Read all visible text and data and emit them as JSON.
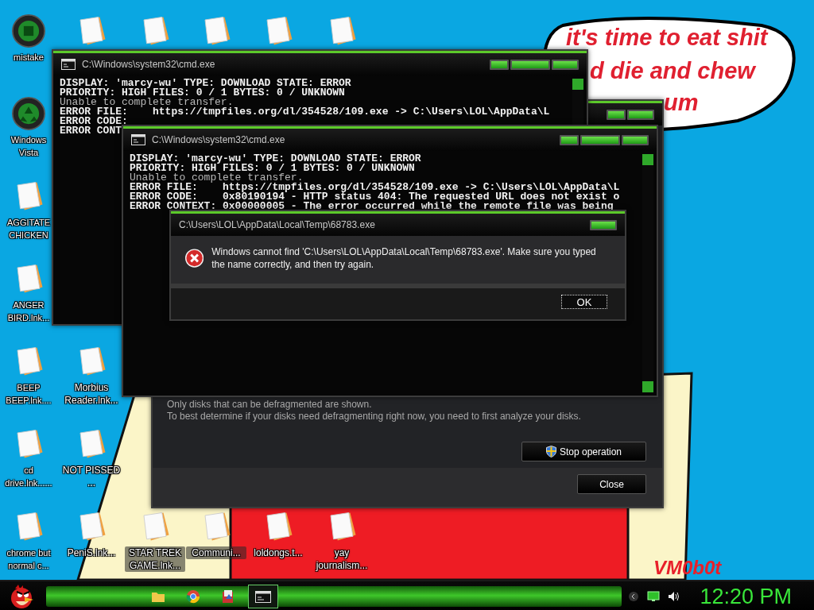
{
  "desktop": {
    "columns": [
      [
        {
          "kind": "disc",
          "label": "mistake"
        },
        {
          "kind": "recycle",
          "label": "Windows Vista"
        },
        {
          "kind": "file",
          "label": "AGGITATE CHICKEN"
        },
        {
          "kind": "file",
          "label": "ANGER BIRD.lnk..."
        },
        {
          "kind": "file",
          "label": "BEEP BEEP.lnk...."
        },
        {
          "kind": "file",
          "label": "cd drive.lnk......"
        },
        {
          "kind": "file",
          "label": "chrome but normal c..."
        }
      ],
      [
        {
          "kind": "file"
        },
        {
          "kind": "file",
          "label": "Morbius Reader.lnk..."
        },
        {
          "kind": "file",
          "label": "NOT PISSED ..."
        },
        {
          "kind": "file",
          "label": "PeniS.lnk..."
        }
      ],
      [
        {
          "kind": "file"
        },
        {
          "kind": "file",
          "label": "STAR TREK GAME.lnk..."
        }
      ],
      [
        {
          "kind": "file"
        },
        {
          "kind": "file",
          "label": "Communi..."
        }
      ],
      [
        {
          "kind": "file"
        },
        {
          "kind": "file",
          "label": "loldongs.t..."
        }
      ],
      [
        {
          "kind": "file"
        },
        {
          "kind": "file",
          "label": "yay journalism..."
        }
      ]
    ],
    "speech_bubble": {
      "lines": [
        "it's time to eat shit",
        "d die and chew",
        "um"
      ]
    },
    "wallpaper_text": "VM0b0t"
  },
  "defrag_window": {
    "info": [
      "Only disks that can be defragmented are shown.",
      "To best determine if your disks need defragmenting right now, you need to first analyze your disks."
    ],
    "stop_button": "Stop operation",
    "close_button": "Close"
  },
  "console_back": {
    "title": "C:\\Windows\\system32\\cmd.exe",
    "lines": [
      {
        "text": "DISPLAY: 'marcy-wu' TYPE: DOWNLOAD STATE: ERROR",
        "dim": false
      },
      {
        "text": "PRIORITY: HIGH FILES: 0 / 1 BYTES: 0 / UNKNOWN",
        "dim": false
      },
      {
        "text": "Unable to complete transfer.",
        "dim": true
      },
      {
        "text": "ERROR FILE:    https://tmpfiles.org/dl/354528/109.exe -> C:\\Users\\LOL\\AppData\\L",
        "dim": false
      },
      {
        "text": "ERROR CODE:",
        "dim": false
      },
      {
        "text": "ERROR CONT",
        "dim": false
      }
    ]
  },
  "console_front": {
    "title": "C:\\Windows\\system32\\cmd.exe",
    "lines": [
      {
        "text": "DISPLAY: 'marcy-wu' TYPE: DOWNLOAD STATE: ERROR",
        "dim": false
      },
      {
        "text": "PRIORITY: HIGH FILES: 0 / 1 BYTES: 0 / UNKNOWN",
        "dim": false
      },
      {
        "text": "Unable to complete transfer.",
        "dim": true
      },
      {
        "text": "ERROR FILE:    https://tmpfiles.org/dl/354528/109.exe -> C:\\Users\\LOL\\AppData\\L",
        "dim": false
      },
      {
        "text": "ERROR CODE:    0x80190194 - HTTP status 404: The requested URL does not exist o",
        "dim": false
      },
      {
        "text": "ERROR CONTEXT: 0x00000005 - The error occurred while the remote file was being",
        "dim": false
      }
    ]
  },
  "error_dialog": {
    "title": "C:\\Users\\LOL\\AppData\\Local\\Temp\\68783.exe",
    "message": "Windows cannot find 'C:\\Users\\LOL\\AppData\\Local\\Temp\\68783.exe'. Make sure you typed the name correctly, and then try again.",
    "ok_button": "OK"
  },
  "taskbar": {
    "items": [
      {
        "kind": "folder",
        "selected": false
      },
      {
        "kind": "chrome",
        "selected": false
      },
      {
        "kind": "app",
        "selected": false
      },
      {
        "kind": "cmd",
        "selected": true
      }
    ],
    "clock": "12:20 PM"
  }
}
